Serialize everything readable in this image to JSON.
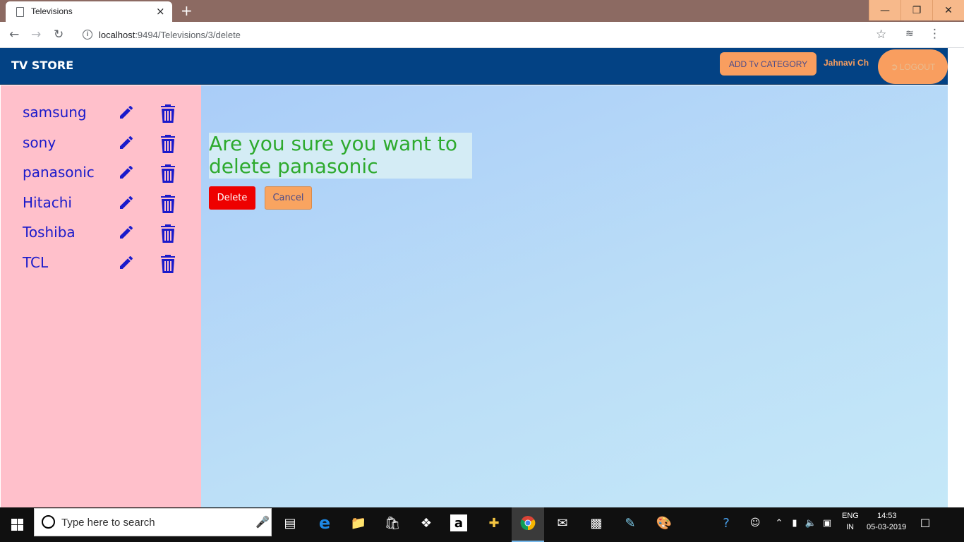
{
  "browser": {
    "tab_title": "Televisions",
    "tab_close": "×",
    "new_tab": "+",
    "url_host": "localhost",
    "url_rest": ":9494/Televisions/3/delete",
    "window_controls": {
      "minimize": "—",
      "restore": "❐",
      "close": "✕"
    }
  },
  "header": {
    "brand": "TV STORE",
    "add_category_label": "ADD Tv CATEGORY",
    "user_name": "Jahnavi Ch",
    "logout_label": "LOGOUT"
  },
  "sidebar": {
    "items": [
      {
        "label": "samsung"
      },
      {
        "label": "sony"
      },
      {
        "label": "panasonic"
      },
      {
        "label": "Hitachi"
      },
      {
        "label": "Toshiba"
      },
      {
        "label": "TCL"
      }
    ]
  },
  "confirm": {
    "message": "Are you sure you want to delete panasonic",
    "delete_label": "Delete",
    "cancel_label": "Cancel"
  },
  "taskbar": {
    "search_placeholder": "Type here to search",
    "language": "ENG",
    "region": "IN",
    "time": "14:53",
    "date": "05-03-2019"
  },
  "colors": {
    "header_bg": "#034284",
    "sidebar_bg": "#ffc0cb",
    "accent_orange": "#f99e5f",
    "delete_red": "#ee0000",
    "confirm_green": "#2eaa2e",
    "category_blue": "#1a1acb"
  }
}
